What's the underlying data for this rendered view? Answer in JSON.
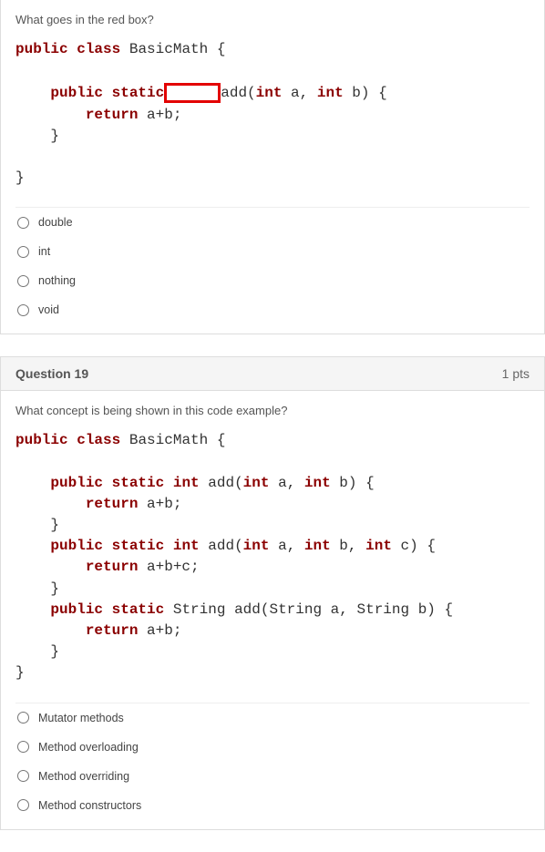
{
  "q1": {
    "prompt": "What goes in the red box?",
    "code": {
      "l1": {
        "kw1": "public",
        "kw2": "class",
        "name": "BasicMath",
        "brace": "{"
      },
      "l2": {
        "kw1": "public",
        "kw2": "static",
        "after": "add(",
        "kw3": "int",
        "mid": " a, ",
        "kw4": "int",
        "end": " b) {"
      },
      "l3": {
        "kw": "return",
        "rest": " a+b;"
      },
      "l4": "    }",
      "l5": "}"
    },
    "options": [
      "double",
      "int",
      "nothing",
      "void"
    ]
  },
  "q2": {
    "header_title": "Question 19",
    "header_pts": "1 pts",
    "prompt": "What concept is being shown in this code example?",
    "code": {
      "l1": {
        "kw1": "public",
        "kw2": "class",
        "name": "BasicMath",
        "brace": "{"
      },
      "m1": {
        "sig": {
          "kw1": "public",
          "kw2": "static",
          "kw3": "int",
          "fn": "add(",
          "kw4": "int",
          "a": " a, ",
          "kw5": "int",
          "b": " b) {"
        },
        "ret": {
          "kw": "return",
          "rest": " a+b;"
        },
        "close": "    }"
      },
      "m2": {
        "sig": {
          "kw1": "public",
          "kw2": "static",
          "kw3": "int",
          "fn": "add(",
          "kw4": "int",
          "a": " a, ",
          "kw5": "int",
          "b": " b, ",
          "kw6": "int",
          "c": " c) {"
        },
        "ret": {
          "kw": "return",
          "rest": " a+b+c;"
        },
        "close": "    }"
      },
      "m3": {
        "sig": {
          "kw1": "public",
          "kw2": "static",
          "typ": "String",
          "fn": "add(String a, String b) {"
        },
        "ret": {
          "kw": "return",
          "rest": " a+b;"
        },
        "close": "    }"
      },
      "end": "}"
    },
    "options": [
      "Mutator methods",
      "Method overloading",
      "Method overriding",
      "Method constructors"
    ]
  }
}
